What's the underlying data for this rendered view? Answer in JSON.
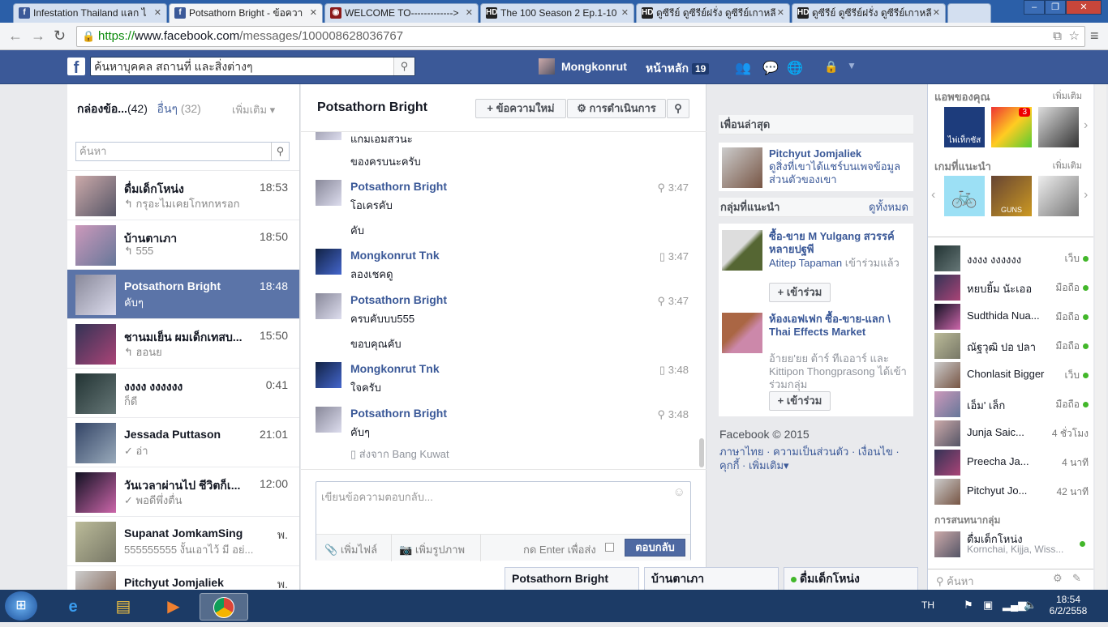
{
  "browser": {
    "tabs": [
      {
        "title": "Infestation Thailand แลก ไ",
        "icon": "facebook-icon"
      },
      {
        "title": "Potsathorn Bright - ข้อควา",
        "icon": "facebook-icon",
        "active": true
      },
      {
        "title": "WELCOME TO------------->",
        "icon": "site-icon"
      },
      {
        "title": "The 100 Season 2 Ep.1-10",
        "icon": "hd-icon"
      },
      {
        "title": "ดูซีรีย์ ดูซีรีย์ฝรั่ง ดูซีรีย์เกาหลี",
        "icon": "hd-icon"
      },
      {
        "title": "ดูซีรีย์ ดูซีรีย์ฝรั่ง ดูซีรีย์เกาหลี",
        "icon": "hd-icon"
      }
    ],
    "url_scheme": "https://",
    "url_host": "www.facebook.com",
    "url_path": "/messages/100008628036767"
  },
  "fb": {
    "search_placeholder": "ค้นหาบุคคล สถานที่ และสิ่งต่างๆ",
    "profile_name": "Mongkonrut",
    "home_label": "หน้าหลัก",
    "home_count": "19"
  },
  "inbox": {
    "tab_inbox": "กล่องข้อ...",
    "tab_inbox_count": "(42)",
    "tab_other": "อื่นๆ",
    "tab_other_count": "(32)",
    "more_label": "เพิ่มเติม",
    "search_placeholder": "ค้นหา",
    "conversations": [
      {
        "name": "ดื่มเด็กโหน่ง",
        "time": "18:53",
        "preview": "↰ กรุอะไมเคยโกหกหรอก"
      },
      {
        "name": "บ้านตาเภา",
        "time": "18:50",
        "preview": "↰ 555"
      },
      {
        "name": "Potsathorn Bright",
        "time": "18:48",
        "preview": "คับๆ"
      },
      {
        "name": "ชานมเย็น ผมเด็กเทสบ...",
        "time": "15:50",
        "preview": "↰ ฮอนย"
      },
      {
        "name": "งงงง งงงงงง",
        "time": "0:41",
        "preview": "ก็ดี"
      },
      {
        "name": "Jessada Puttason",
        "time": "21:01",
        "preview": "✓ อ่า"
      },
      {
        "name": "วันเวลาผ่านไป ชีวิตก็เ...",
        "time": "12:00",
        "preview": "✓ พอดีพึ่งตื่น"
      },
      {
        "name": "Supanat JomkamSing",
        "time": "พ.",
        "preview": "555555555 งั้นเอาไว้ มี อย่..."
      },
      {
        "name": "Pitchyut Jomjaliek",
        "time": "พ.",
        "preview": ""
      }
    ]
  },
  "thread": {
    "title": "Potsathorn Bright",
    "new_message": "ข้อความใหม่",
    "actions": "การดำเนินการ",
    "partial_top": "แกมเอมสวนะ",
    "messages": [
      {
        "text_only": "ของครบนะครับ"
      },
      {
        "name": "Potsathorn Bright",
        "time": "3:47",
        "lines": [
          "โอเครคับ",
          "คับ"
        ]
      },
      {
        "name": "Mongkonrut Tnk",
        "time": "3:47",
        "lines": [
          "ลองเชคดู"
        ]
      },
      {
        "name": "Potsathorn Bright",
        "time": "3:47",
        "lines": [
          "ครบคับบบ555",
          "ขอบคุณคับ"
        ]
      },
      {
        "name": "Mongkonrut Tnk",
        "time": "3:48",
        "lines": [
          "ใจครับ"
        ]
      },
      {
        "name": "Potsathorn Bright",
        "time": "3:48",
        "lines": [
          "คับๆ"
        ]
      }
    ],
    "sent_from": "ส่งจาก Bang Kuwat",
    "reply_placeholder": "เขียนข้อความตอบกลับ...",
    "add_file": "เพิ่มไฟล์",
    "add_photo": "เพิ่มรูปภาพ",
    "enter_to_send": "กด Enter เพื่อส่ง",
    "reply_button": "ตอบกลับ"
  },
  "right": {
    "recent_friends": "เพื่อนล่าสุด",
    "friend_name": "Pitchyut Jomjaliek",
    "friend_desc": "ดูสิ่งที่เขาได้แชร์บนเพจข้อมูลส่วนตัวของเขา",
    "groups_header": "กลุ่มที่แนะนำ",
    "see_all": "ดูทั้งหมด",
    "group1_name": "ซื้อ-ขาย M Yulgang สวรรค์หลายปฐพี",
    "group1_member": "Atitep Tapaman",
    "group1_desc": " เข้าร่วมแล้ว",
    "group2_name": "ห้องเอฟเฟก ซื้อ-ขาย-แลก \\ Thai Effects Market",
    "group2_desc": "อ้ายย'ยย ต้าร์ ทีเออาร์ และ Kittipon Thongprasong ได้เข้าร่วมกลุ่ม",
    "join_label": "เข้าร่วม",
    "copyright": "Facebook © 2015",
    "footer_links": "ภาษาไทย · ความเป็นส่วนตัว · เงื่อนไข · คุกกี้ · เพิ่มเติม▾"
  },
  "chat": {
    "apps_header": "แอพของคุณ",
    "more": "เพิ่มเติม",
    "games_header": "เกมที่แนะนำ",
    "app_label_1": "ไพ่เท็กซัส",
    "app_badge": "3",
    "game_label_2": "GUNS RUSH",
    "contacts": [
      {
        "name": "งงงง งงงงงง",
        "status": "เว็บ"
      },
      {
        "name": "หยบยิ้ม นัะเออ",
        "status": "มือถือ"
      },
      {
        "name": "Sudthida Nua...",
        "status": "มือถือ"
      },
      {
        "name": "ณัฐวุฒิ ปอ ปลา",
        "status": "มือถือ"
      },
      {
        "name": "Chonlasit Bigger",
        "status": "เว็บ"
      },
      {
        "name": "เอ็ม' เล็ก",
        "status": "มือถือ"
      },
      {
        "name": "Junja Saic...",
        "status": "4 ชั่วโมง"
      },
      {
        "name": "Preecha Ja...",
        "status": "4 นาที"
      },
      {
        "name": "Pitchyut Jo...",
        "status": "42 นาที"
      }
    ],
    "group_chats_header": "การสนทนากลุ่ม",
    "group_chat_name": "ดื่มเด็กโหน่ง",
    "group_chat_members": "Kornchai, Kijja, Wiss...",
    "search": "ค้นหา"
  },
  "dock": {
    "tab1": "Potsathorn Bright",
    "tab2": "บ้านตาเภา",
    "tab3": "ดื่มเด็กโหน่ง"
  },
  "taskbar": {
    "lang": "TH",
    "time": "18:54",
    "date": "6/2/2558"
  }
}
